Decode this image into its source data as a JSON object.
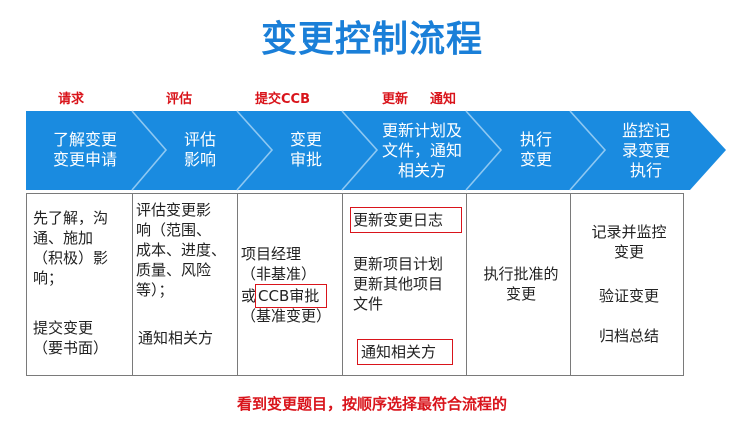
{
  "title": "变更控制流程",
  "stages": {
    "request": "请求",
    "evaluate": "评估",
    "submit_ccb": "提交CCB",
    "update": "更新",
    "notify": "通知"
  },
  "steps": [
    {
      "label": "了解变更\n变更申请"
    },
    {
      "label": "评估\n影响"
    },
    {
      "label": "变更\n审批"
    },
    {
      "label": "更新计划及\n文件，通知\n相关方"
    },
    {
      "label": "执行\n变更"
    },
    {
      "label": "监控记\n录变更\n执行"
    }
  ],
  "details": {
    "col1_a": "先了解，沟\n通、施加\n（积极）影\n响；",
    "col1_b": "提交变更\n（要书面）",
    "col2_a": "评估变更影\n响（范围、\n成本、进度、\n质量、风险\n等）；",
    "col2_b": "通知相关方",
    "col3_a": "项目经理\n（非基准）",
    "col3_or": "或",
    "col3_ccb": "CCB审批",
    "col3_b": "（基准变更）",
    "col4_log": "更新变更日志",
    "col4_plan": "更新项目计划\n更新其他项目\n文件",
    "col4_notify": "通知相关方",
    "col5": "执行批准的\n变更",
    "col6_a": "记录并监控\n变更",
    "col6_b": "验证变更",
    "col6_c": "归档总结"
  },
  "footer": "看到变更题目，按顺序选择最符合流程的",
  "colors": {
    "title": "#1a7fd8",
    "band": "#1a8be0",
    "accent_red": "#d9141b"
  }
}
